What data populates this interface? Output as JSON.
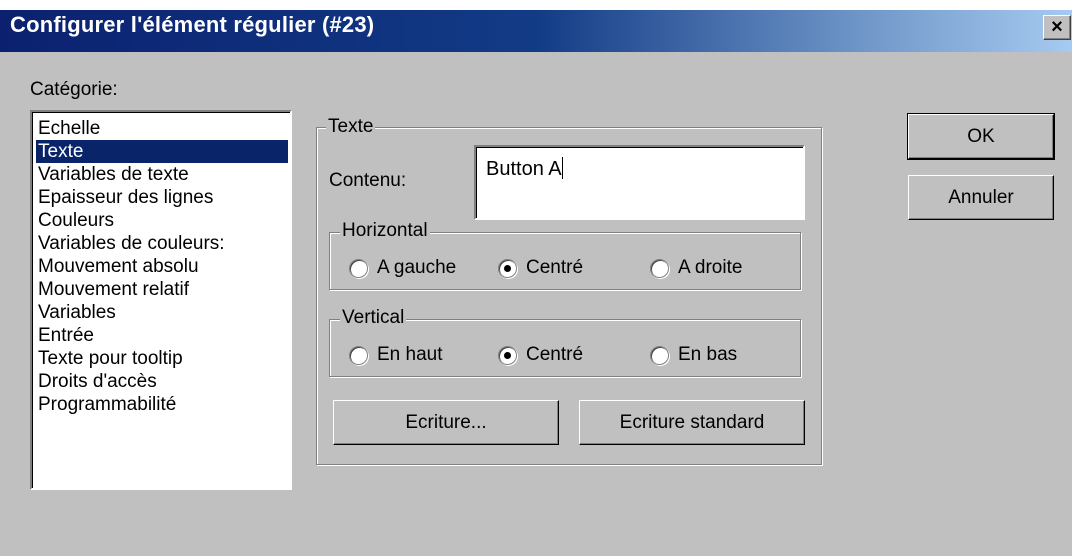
{
  "window": {
    "title": "Configurer l'élément régulier (#23)",
    "close_glyph": "×"
  },
  "category": {
    "label": "Catégorie:",
    "items": [
      {
        "label": "Echelle",
        "selected": false
      },
      {
        "label": "Texte",
        "selected": true
      },
      {
        "label": "Variables de texte",
        "selected": false
      },
      {
        "label": "Epaisseur des lignes",
        "selected": false
      },
      {
        "label": "Couleurs",
        "selected": false
      },
      {
        "label": "Variables de couleurs:",
        "selected": false
      },
      {
        "label": "Mouvement absolu",
        "selected": false
      },
      {
        "label": "Mouvement relatif",
        "selected": false
      },
      {
        "label": "Variables",
        "selected": false
      },
      {
        "label": "Entrée",
        "selected": false
      },
      {
        "label": "Texte pour tooltip",
        "selected": false
      },
      {
        "label": "Droits d'accès",
        "selected": false
      },
      {
        "label": "Programmabilité",
        "selected": false
      }
    ]
  },
  "texte": {
    "group_label": "Texte",
    "content_label": "Contenu:",
    "content_value": "Button A",
    "horizontal": {
      "label": "Horizontal",
      "options": [
        "A gauche",
        "Centré",
        "A droite"
      ],
      "selected": "Centré"
    },
    "vertical": {
      "label": "Vertical",
      "options": [
        "En haut",
        "Centré",
        "En bas"
      ],
      "selected": "Centré"
    },
    "font_button": "Ecriture...",
    "standard_font_button": "Ecriture standard"
  },
  "buttons": {
    "ok": "OK",
    "cancel": "Annuler"
  },
  "colors": {
    "selection": "#0a246a",
    "titlebar": "#0b2170",
    "face": "#c0c0c0"
  }
}
